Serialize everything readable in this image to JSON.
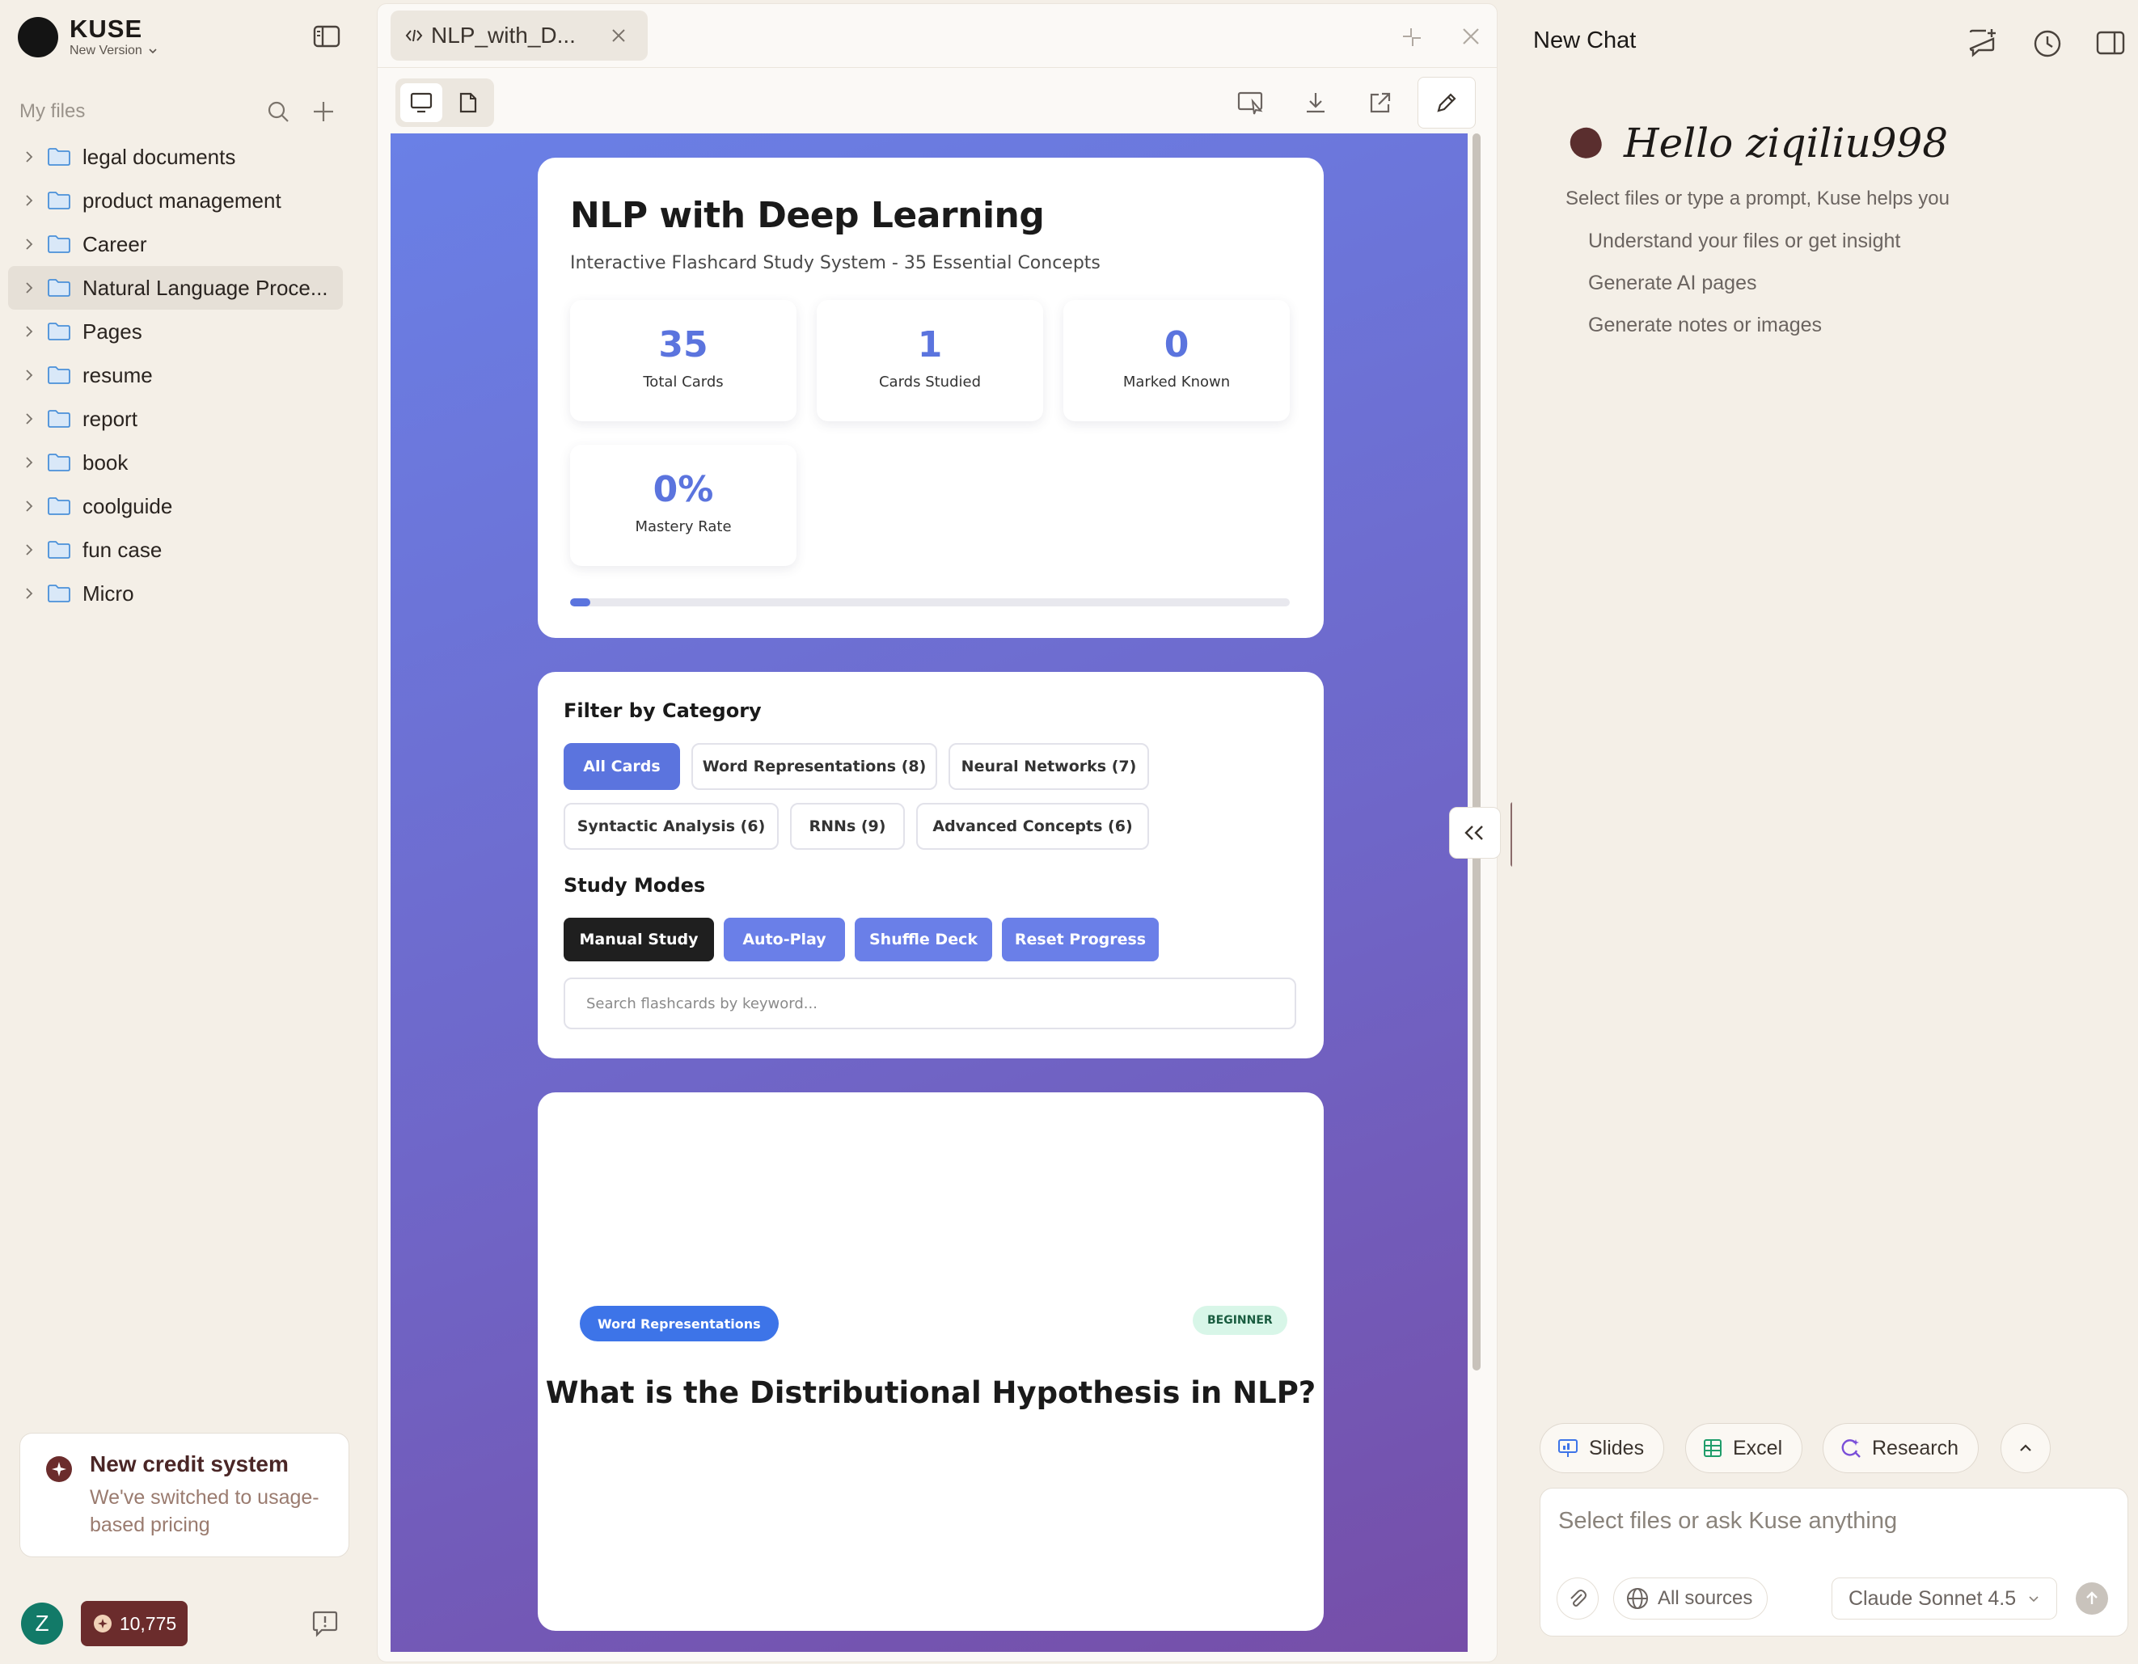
{
  "brand": {
    "name": "KUSE",
    "version_label": "New Version"
  },
  "files": {
    "title": "My files",
    "folders": [
      {
        "label": "legal documents"
      },
      {
        "label": "product management"
      },
      {
        "label": "Career"
      },
      {
        "label": "Natural Language Proce..."
      },
      {
        "label": "Pages"
      },
      {
        "label": "resume"
      },
      {
        "label": "report"
      },
      {
        "label": "book"
      },
      {
        "label": "coolguide"
      },
      {
        "label": "fun case"
      },
      {
        "label": "Micro"
      }
    ]
  },
  "credit_notice": {
    "title": "New credit system",
    "description": "We've switched to usage-based pricing"
  },
  "user": {
    "initial": "Z",
    "credits": "10,775"
  },
  "center": {
    "tab_label": "NLP_with_D..."
  },
  "flashcards": {
    "title": "NLP with Deep Learning",
    "subtitle": "Interactive Flashcard Study System - 35 Essential Concepts",
    "stats": [
      {
        "value": "35",
        "label": "Total Cards"
      },
      {
        "value": "1",
        "label": "Cards Studied"
      },
      {
        "value": "0",
        "label": "Marked Known"
      },
      {
        "value": "0%",
        "label": "Mastery Rate"
      }
    ],
    "progress_fraction": 0.028,
    "filter_title": "Filter by Category",
    "categories": [
      "All Cards",
      "Word Representations (8)",
      "Neural Networks (7)",
      "Syntactic Analysis (6)",
      "RNNs (9)",
      "Advanced Concepts (6)"
    ],
    "modes_title": "Study Modes",
    "modes": [
      "Manual Study",
      "Auto-Play",
      "Shuffle Deck",
      "Reset Progress"
    ],
    "search_placeholder": "Search flashcards by keyword...",
    "card": {
      "category": "Word Representations",
      "level": "BEGINNER",
      "question": "What is the Distributional Hypothesis in NLP?"
    }
  },
  "chat": {
    "title": "New Chat",
    "greeting": "Hello ziqiliu998",
    "helper": "Select files or type a prompt, Kuse helps you",
    "suggestions": [
      "Understand your files or get insight",
      "Generate AI pages",
      "Generate notes or images"
    ],
    "actions": [
      "Slides",
      "Excel",
      "Research"
    ],
    "input_placeholder": "Select files or ask Kuse anything",
    "sources_label": "All sources",
    "model_label": "Claude Sonnet 4.5"
  },
  "colors": {
    "accent": "#5b74de",
    "brand_dark": "#6b2c2c",
    "avatar": "#127a68"
  }
}
